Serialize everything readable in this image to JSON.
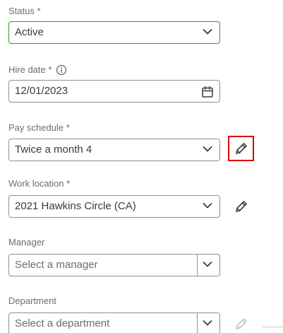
{
  "status": {
    "label": "Status *",
    "value": "Active"
  },
  "hire_date": {
    "label": "Hire date *",
    "value": "12/01/2023"
  },
  "pay_schedule": {
    "label": "Pay schedule *",
    "value": "Twice a month 4"
  },
  "work_location": {
    "label": "Work location *",
    "value": "2021 Hawkins Circle (CA)"
  },
  "manager": {
    "label": "Manager",
    "placeholder": "Select a manager"
  },
  "department": {
    "label": "Department",
    "placeholder": "Select a department"
  },
  "colors": {
    "active_border": "#2ca01c",
    "highlight": "#d9000f",
    "border": "#8d9096",
    "text": "#393a3d",
    "label": "#6b6c72"
  },
  "icons": {
    "chevron": "chevron-down-icon",
    "info": "info-icon",
    "calendar": "calendar-icon",
    "edit": "pencil-icon"
  }
}
